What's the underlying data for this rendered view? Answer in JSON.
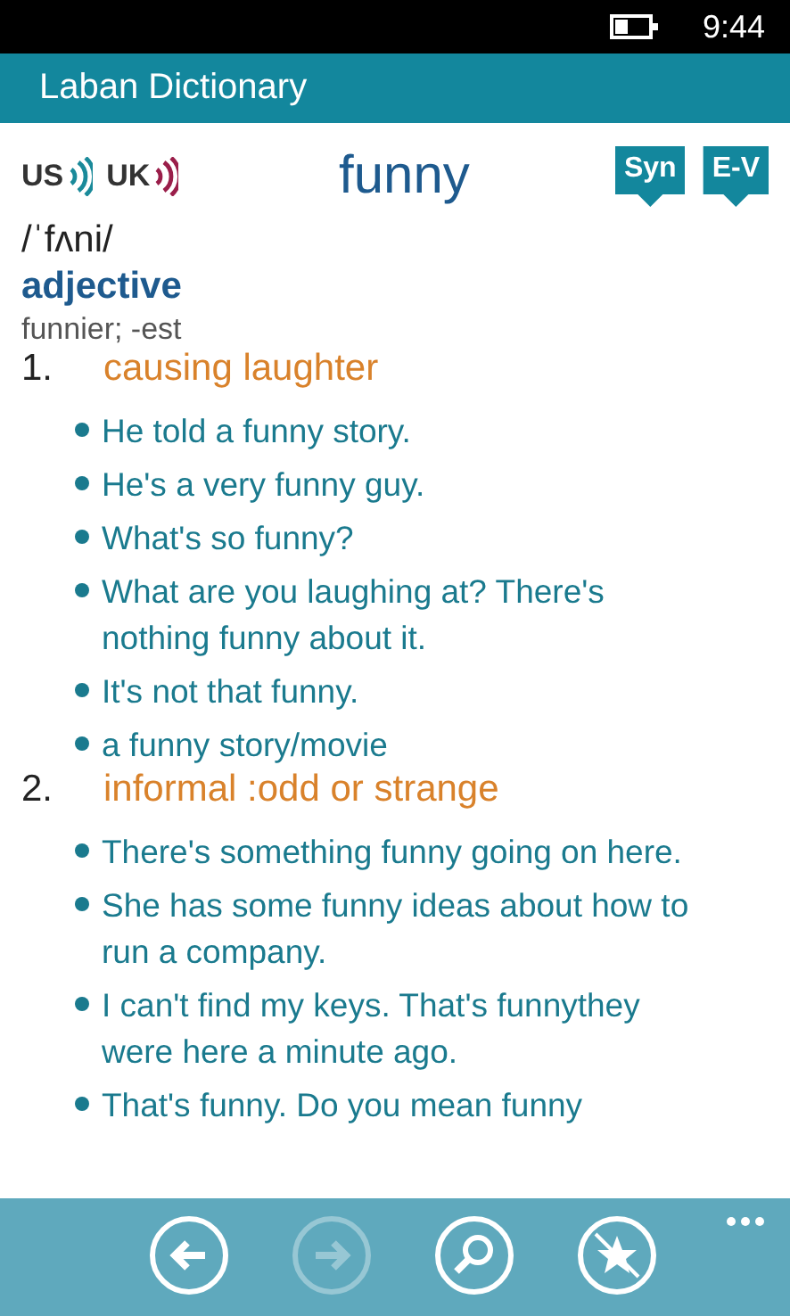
{
  "status_bar": {
    "time": "9:44"
  },
  "title_bar": {
    "title": "Laban Dictionary"
  },
  "header": {
    "pronunciations": [
      {
        "label": "US",
        "color": "#1a8a9a"
      },
      {
        "label": "UK",
        "color": "#9a1e4a"
      }
    ],
    "word": "funny",
    "buttons": [
      "Syn",
      "E-V"
    ]
  },
  "entry": {
    "phonetic": "/ˈfʌni/",
    "part_of_speech": "adjective",
    "forms": "funnier; -est",
    "senses": [
      {
        "number": "1.",
        "definition": "causing laughter",
        "examples": [
          "He told a funny story.",
          "He's a very funny guy.",
          "What's so funny?",
          "What are you laughing at? There's nothing funny about it.",
          "It's not that funny.",
          "a funny story/movie"
        ]
      },
      {
        "number": "2.",
        "definition": "informal :odd or strange",
        "examples": [
          "There's something funny going on here.",
          "She has some funny ideas about how to run a company.",
          "I can't find my keys. That's funnythey were here a minute ago.",
          "That's funny. Do you mean funny"
        ]
      }
    ]
  },
  "app_bar": {
    "buttons": [
      {
        "kind": "back",
        "disabled": false
      },
      {
        "kind": "forward",
        "disabled": true
      },
      {
        "kind": "search",
        "disabled": false
      },
      {
        "kind": "unfavorite",
        "disabled": false
      }
    ]
  }
}
